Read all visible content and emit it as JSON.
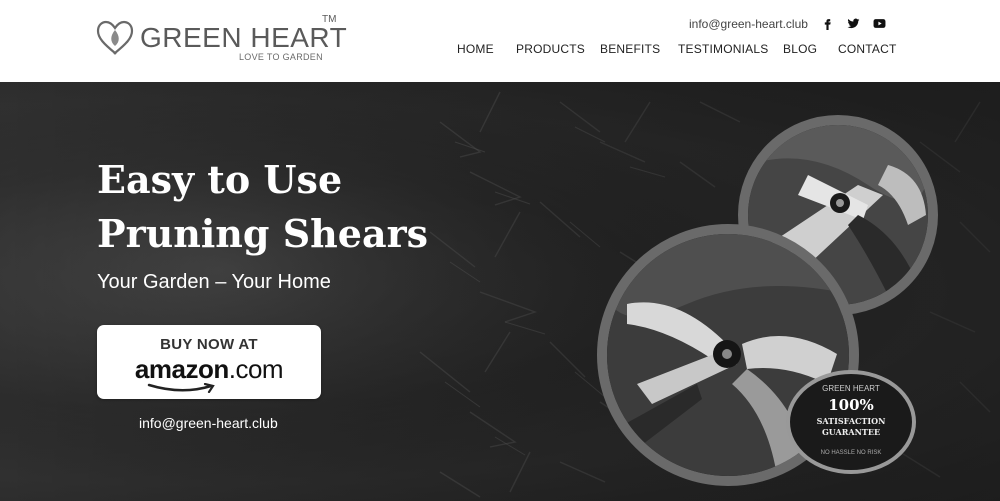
{
  "brand": {
    "name": "GREEN HEART",
    "trademark": "TM",
    "tagline": "LOVE TO GARDEN"
  },
  "header": {
    "email": "info@green-heart.club",
    "social": [
      {
        "icon": "facebook-icon"
      },
      {
        "icon": "twitter-icon"
      },
      {
        "icon": "youtube-icon"
      }
    ],
    "nav": [
      "HOME",
      "PRODUCTS",
      "BENEFITS",
      "TESTIMONIALS",
      "BLOG",
      "CONTACT"
    ]
  },
  "hero": {
    "headline_line1": "Easy to Use",
    "headline_line2": "Pruning Shears",
    "subline": "Your Garden – Your Home",
    "cta_top": "BUY NOW AT",
    "cta_brand": "amazon",
    "cta_domain": ".com",
    "email": "info@green-heart.club"
  },
  "badge": {
    "brand": "GREEN HEART",
    "big": "100%",
    "line1": "SATISFACTION",
    "line2": "GUARANTEE",
    "small": "NO HASSLE NO RISK"
  },
  "colors": {
    "text_dark": "#222222",
    "hero_text": "#ffffff",
    "logo_gray": "#5a5a5a"
  }
}
